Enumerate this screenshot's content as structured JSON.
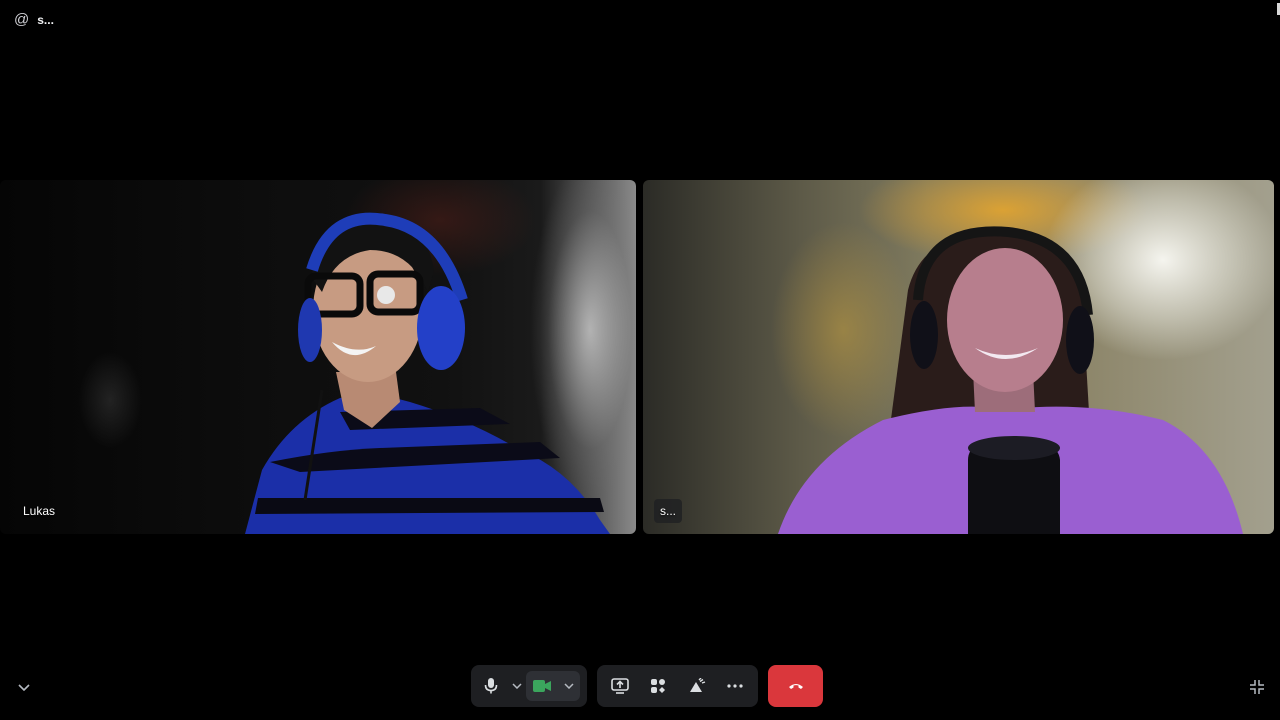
{
  "header": {
    "channel_icon": "at-icon",
    "channel_name": "s..."
  },
  "participants": [
    {
      "name": "Lukas"
    },
    {
      "name": "s..."
    }
  ],
  "controls": {
    "mic": "microphone-icon",
    "camera": "camera-icon",
    "share": "screen-share-icon",
    "activities": "activities-icon",
    "soundboard": "soundboard-icon",
    "more": "more-icon",
    "hangup": "hang-up-icon"
  },
  "colors": {
    "background": "#000000",
    "control_bar": "#1e1f22",
    "camera_active": "#3ba55d",
    "hangup": "#da373c"
  }
}
